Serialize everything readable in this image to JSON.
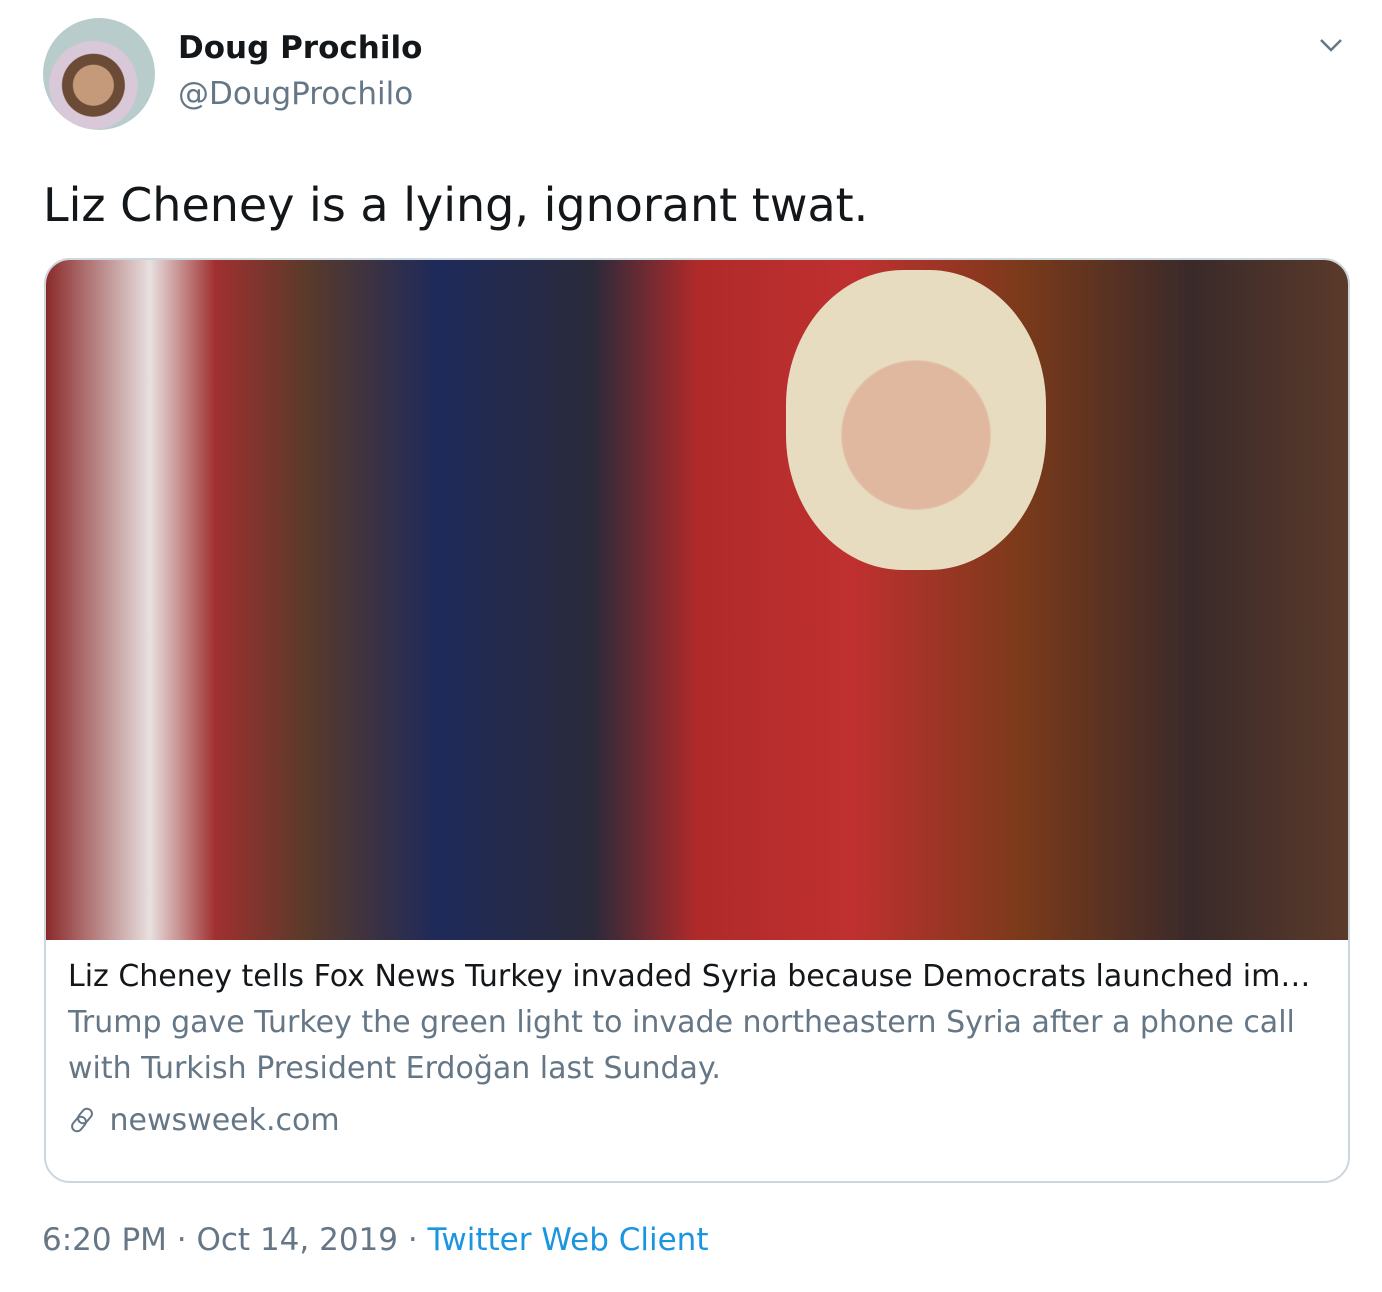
{
  "user": {
    "name": "Doug Prochilo",
    "handle": "@DougProchilo"
  },
  "tweet": {
    "text": "Liz Cheney is a lying, ignorant twat."
  },
  "card": {
    "title": "Liz Cheney tells Fox News Turkey invaded Syria because Democrats launched impeachment inquiry",
    "description": "Trump gave Turkey the green light to invade northeastern Syria after a phone call with Turkish President Erdoğan last Sunday.",
    "domain": "newsweek.com"
  },
  "meta": {
    "time": "6:20 PM",
    "sep": " · ",
    "date": "Oct 14, 2019",
    "source": "Twitter Web Client"
  }
}
